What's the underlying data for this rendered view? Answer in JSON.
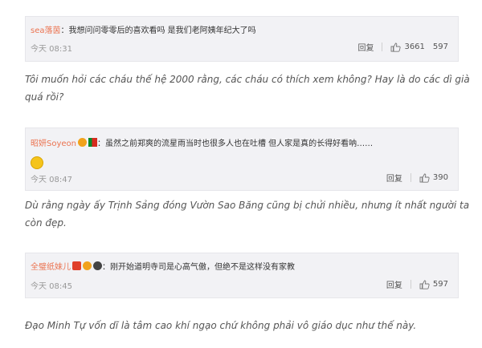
{
  "comments": [
    {
      "username": "sea落茵",
      "text": "：我想问问零零后的喜欢看吗 是我们老阿姨年纪大了吗",
      "time": "今天 08:31",
      "reply_label": "回复",
      "likes": "3661",
      "extra_count": "597",
      "translation": "Tôi muốn hỏi các cháu thế hệ 2000 rằng, các cháu có thích xem không? Hay là do các dì già quá rồi?"
    },
    {
      "username": "昭妍Soyeon",
      "text": "：虽然之前郑爽的流星雨当时也很多人也在吐槽 但人家是真的长得好看呐……",
      "time": "今天 08:47",
      "reply_label": "回复",
      "likes": "390",
      "translation": "Dù rằng ngày ấy Trịnh Sảng đóng Vườn Sao Băng cũng bị chửi nhiều, nhưng ít nhất người ta còn đẹp."
    },
    {
      "username": "全璧纸妹儿",
      "text": "：刚开始道明寺司是心高气傲，但绝不是这样没有家教",
      "time": "今天 08:45",
      "reply_label": "回复",
      "likes": "597",
      "translation": "Đạo Minh Tự vốn dĩ là tâm cao khí ngạo chứ không phải vô giáo dục như thế này."
    }
  ],
  "icons": {
    "like": "thumbs-up-icon",
    "emoji": "smile-emoji-icon"
  },
  "colors": {
    "username": "#eb7350",
    "card_bg": "#f2f2f5",
    "time": "#999999",
    "translation": "#555555"
  }
}
